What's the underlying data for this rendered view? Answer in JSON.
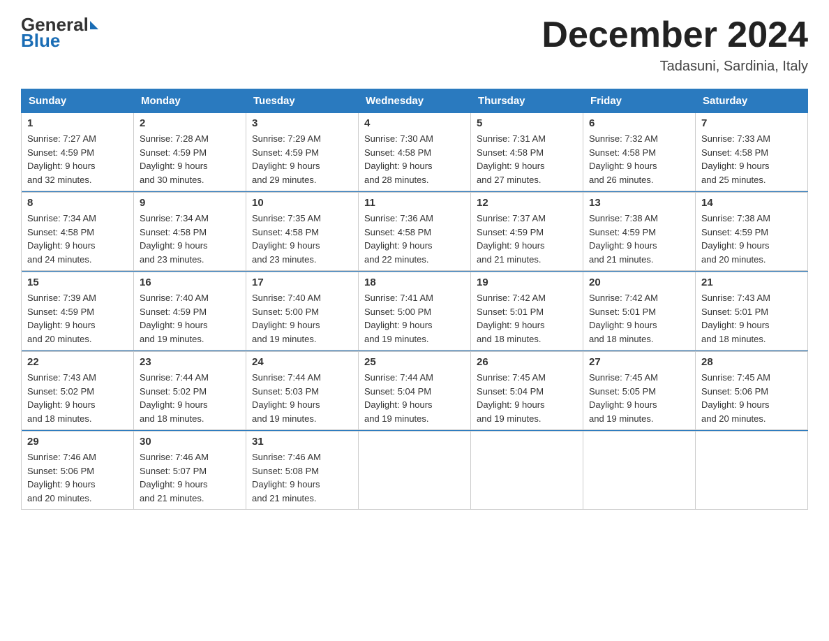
{
  "header": {
    "logo_general": "General",
    "logo_blue": "Blue",
    "month_title": "December 2024",
    "location": "Tadasuni, Sardinia, Italy"
  },
  "columns": [
    "Sunday",
    "Monday",
    "Tuesday",
    "Wednesday",
    "Thursday",
    "Friday",
    "Saturday"
  ],
  "weeks": [
    [
      {
        "day": "1",
        "sunrise": "7:27 AM",
        "sunset": "4:59 PM",
        "daylight": "9 hours and 32 minutes."
      },
      {
        "day": "2",
        "sunrise": "7:28 AM",
        "sunset": "4:59 PM",
        "daylight": "9 hours and 30 minutes."
      },
      {
        "day": "3",
        "sunrise": "7:29 AM",
        "sunset": "4:59 PM",
        "daylight": "9 hours and 29 minutes."
      },
      {
        "day": "4",
        "sunrise": "7:30 AM",
        "sunset": "4:58 PM",
        "daylight": "9 hours and 28 minutes."
      },
      {
        "day": "5",
        "sunrise": "7:31 AM",
        "sunset": "4:58 PM",
        "daylight": "9 hours and 27 minutes."
      },
      {
        "day": "6",
        "sunrise": "7:32 AM",
        "sunset": "4:58 PM",
        "daylight": "9 hours and 26 minutes."
      },
      {
        "day": "7",
        "sunrise": "7:33 AM",
        "sunset": "4:58 PM",
        "daylight": "9 hours and 25 minutes."
      }
    ],
    [
      {
        "day": "8",
        "sunrise": "7:34 AM",
        "sunset": "4:58 PM",
        "daylight": "9 hours and 24 minutes."
      },
      {
        "day": "9",
        "sunrise": "7:34 AM",
        "sunset": "4:58 PM",
        "daylight": "9 hours and 23 minutes."
      },
      {
        "day": "10",
        "sunrise": "7:35 AM",
        "sunset": "4:58 PM",
        "daylight": "9 hours and 23 minutes."
      },
      {
        "day": "11",
        "sunrise": "7:36 AM",
        "sunset": "4:58 PM",
        "daylight": "9 hours and 22 minutes."
      },
      {
        "day": "12",
        "sunrise": "7:37 AM",
        "sunset": "4:59 PM",
        "daylight": "9 hours and 21 minutes."
      },
      {
        "day": "13",
        "sunrise": "7:38 AM",
        "sunset": "4:59 PM",
        "daylight": "9 hours and 21 minutes."
      },
      {
        "day": "14",
        "sunrise": "7:38 AM",
        "sunset": "4:59 PM",
        "daylight": "9 hours and 20 minutes."
      }
    ],
    [
      {
        "day": "15",
        "sunrise": "7:39 AM",
        "sunset": "4:59 PM",
        "daylight": "9 hours and 20 minutes."
      },
      {
        "day": "16",
        "sunrise": "7:40 AM",
        "sunset": "4:59 PM",
        "daylight": "9 hours and 19 minutes."
      },
      {
        "day": "17",
        "sunrise": "7:40 AM",
        "sunset": "5:00 PM",
        "daylight": "9 hours and 19 minutes."
      },
      {
        "day": "18",
        "sunrise": "7:41 AM",
        "sunset": "5:00 PM",
        "daylight": "9 hours and 19 minutes."
      },
      {
        "day": "19",
        "sunrise": "7:42 AM",
        "sunset": "5:01 PM",
        "daylight": "9 hours and 18 minutes."
      },
      {
        "day": "20",
        "sunrise": "7:42 AM",
        "sunset": "5:01 PM",
        "daylight": "9 hours and 18 minutes."
      },
      {
        "day": "21",
        "sunrise": "7:43 AM",
        "sunset": "5:01 PM",
        "daylight": "9 hours and 18 minutes."
      }
    ],
    [
      {
        "day": "22",
        "sunrise": "7:43 AM",
        "sunset": "5:02 PM",
        "daylight": "9 hours and 18 minutes."
      },
      {
        "day": "23",
        "sunrise": "7:44 AM",
        "sunset": "5:02 PM",
        "daylight": "9 hours and 18 minutes."
      },
      {
        "day": "24",
        "sunrise": "7:44 AM",
        "sunset": "5:03 PM",
        "daylight": "9 hours and 19 minutes."
      },
      {
        "day": "25",
        "sunrise": "7:44 AM",
        "sunset": "5:04 PM",
        "daylight": "9 hours and 19 minutes."
      },
      {
        "day": "26",
        "sunrise": "7:45 AM",
        "sunset": "5:04 PM",
        "daylight": "9 hours and 19 minutes."
      },
      {
        "day": "27",
        "sunrise": "7:45 AM",
        "sunset": "5:05 PM",
        "daylight": "9 hours and 19 minutes."
      },
      {
        "day": "28",
        "sunrise": "7:45 AM",
        "sunset": "5:06 PM",
        "daylight": "9 hours and 20 minutes."
      }
    ],
    [
      {
        "day": "29",
        "sunrise": "7:46 AM",
        "sunset": "5:06 PM",
        "daylight": "9 hours and 20 minutes."
      },
      {
        "day": "30",
        "sunrise": "7:46 AM",
        "sunset": "5:07 PM",
        "daylight": "9 hours and 21 minutes."
      },
      {
        "day": "31",
        "sunrise": "7:46 AM",
        "sunset": "5:08 PM",
        "daylight": "9 hours and 21 minutes."
      },
      null,
      null,
      null,
      null
    ]
  ]
}
